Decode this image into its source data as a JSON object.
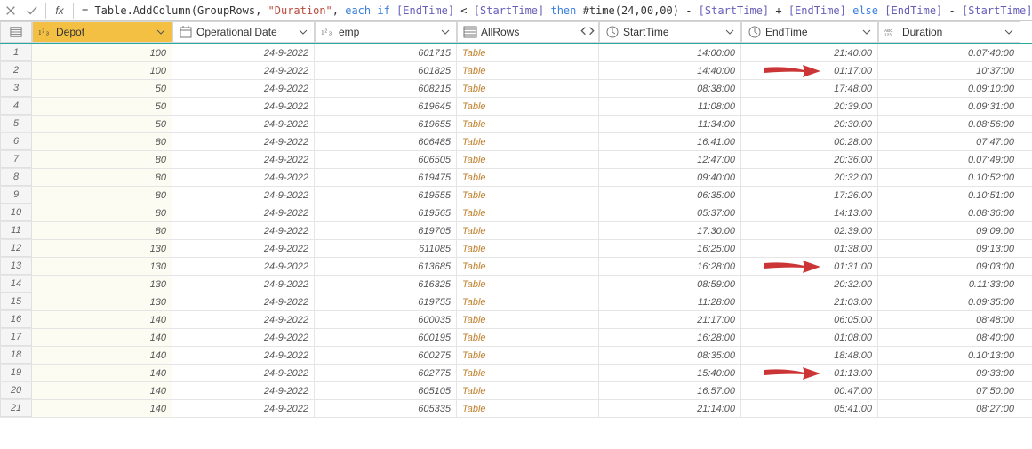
{
  "formula": {
    "raw": "= Table.AddColumn(GroupRows, \"Duration\", each if [EndTime] < [StartTime] then #time(24,00,00) - [StartTime] + [EndTime] else [EndTime] - [StartTime])"
  },
  "columns": {
    "depot": "Depot",
    "opdate": "Operational Date",
    "emp": "emp",
    "allrows": "AllRows",
    "start": "StartTime",
    "end": "EndTime",
    "duration": "Duration"
  },
  "rows": [
    {
      "n": "1",
      "depot": "100",
      "date": "24-9-2022",
      "emp": "601715",
      "all": "Table",
      "start": "14:00:00",
      "end": "21:40:00",
      "dur": "0.07:40:00"
    },
    {
      "n": "2",
      "depot": "100",
      "date": "24-9-2022",
      "emp": "601825",
      "all": "Table",
      "start": "14:40:00",
      "end": "01:17:00",
      "dur": "10:37:00",
      "arrow": true
    },
    {
      "n": "3",
      "depot": "50",
      "date": "24-9-2022",
      "emp": "608215",
      "all": "Table",
      "start": "08:38:00",
      "end": "17:48:00",
      "dur": "0.09:10:00"
    },
    {
      "n": "4",
      "depot": "50",
      "date": "24-9-2022",
      "emp": "619645",
      "all": "Table",
      "start": "11:08:00",
      "end": "20:39:00",
      "dur": "0.09:31:00"
    },
    {
      "n": "5",
      "depot": "50",
      "date": "24-9-2022",
      "emp": "619655",
      "all": "Table",
      "start": "11:34:00",
      "end": "20:30:00",
      "dur": "0.08:56:00"
    },
    {
      "n": "6",
      "depot": "80",
      "date": "24-9-2022",
      "emp": "606485",
      "all": "Table",
      "start": "16:41:00",
      "end": "00:28:00",
      "dur": "07:47:00"
    },
    {
      "n": "7",
      "depot": "80",
      "date": "24-9-2022",
      "emp": "606505",
      "all": "Table",
      "start": "12:47:00",
      "end": "20:36:00",
      "dur": "0.07:49:00"
    },
    {
      "n": "8",
      "depot": "80",
      "date": "24-9-2022",
      "emp": "619475",
      "all": "Table",
      "start": "09:40:00",
      "end": "20:32:00",
      "dur": "0.10:52:00"
    },
    {
      "n": "9",
      "depot": "80",
      "date": "24-9-2022",
      "emp": "619555",
      "all": "Table",
      "start": "06:35:00",
      "end": "17:26:00",
      "dur": "0.10:51:00"
    },
    {
      "n": "10",
      "depot": "80",
      "date": "24-9-2022",
      "emp": "619565",
      "all": "Table",
      "start": "05:37:00",
      "end": "14:13:00",
      "dur": "0.08:36:00"
    },
    {
      "n": "11",
      "depot": "80",
      "date": "24-9-2022",
      "emp": "619705",
      "all": "Table",
      "start": "17:30:00",
      "end": "02:39:00",
      "dur": "09:09:00"
    },
    {
      "n": "12",
      "depot": "130",
      "date": "24-9-2022",
      "emp": "611085",
      "all": "Table",
      "start": "16:25:00",
      "end": "01:38:00",
      "dur": "09:13:00"
    },
    {
      "n": "13",
      "depot": "130",
      "date": "24-9-2022",
      "emp": "613685",
      "all": "Table",
      "start": "16:28:00",
      "end": "01:31:00",
      "dur": "09:03:00",
      "arrow": true
    },
    {
      "n": "14",
      "depot": "130",
      "date": "24-9-2022",
      "emp": "616325",
      "all": "Table",
      "start": "08:59:00",
      "end": "20:32:00",
      "dur": "0.11:33:00"
    },
    {
      "n": "15",
      "depot": "130",
      "date": "24-9-2022",
      "emp": "619755",
      "all": "Table",
      "start": "11:28:00",
      "end": "21:03:00",
      "dur": "0.09:35:00"
    },
    {
      "n": "16",
      "depot": "140",
      "date": "24-9-2022",
      "emp": "600035",
      "all": "Table",
      "start": "21:17:00",
      "end": "06:05:00",
      "dur": "08:48:00"
    },
    {
      "n": "17",
      "depot": "140",
      "date": "24-9-2022",
      "emp": "600195",
      "all": "Table",
      "start": "16:28:00",
      "end": "01:08:00",
      "dur": "08:40:00"
    },
    {
      "n": "18",
      "depot": "140",
      "date": "24-9-2022",
      "emp": "600275",
      "all": "Table",
      "start": "08:35:00",
      "end": "18:48:00",
      "dur": "0.10:13:00"
    },
    {
      "n": "19",
      "depot": "140",
      "date": "24-9-2022",
      "emp": "602775",
      "all": "Table",
      "start": "15:40:00",
      "end": "01:13:00",
      "dur": "09:33:00",
      "arrow": true
    },
    {
      "n": "20",
      "depot": "140",
      "date": "24-9-2022",
      "emp": "605105",
      "all": "Table",
      "start": "16:57:00",
      "end": "00:47:00",
      "dur": "07:50:00"
    },
    {
      "n": "21",
      "depot": "140",
      "date": "24-9-2022",
      "emp": "605335",
      "all": "Table",
      "start": "21:14:00",
      "end": "05:41:00",
      "dur": "08:27:00"
    }
  ]
}
